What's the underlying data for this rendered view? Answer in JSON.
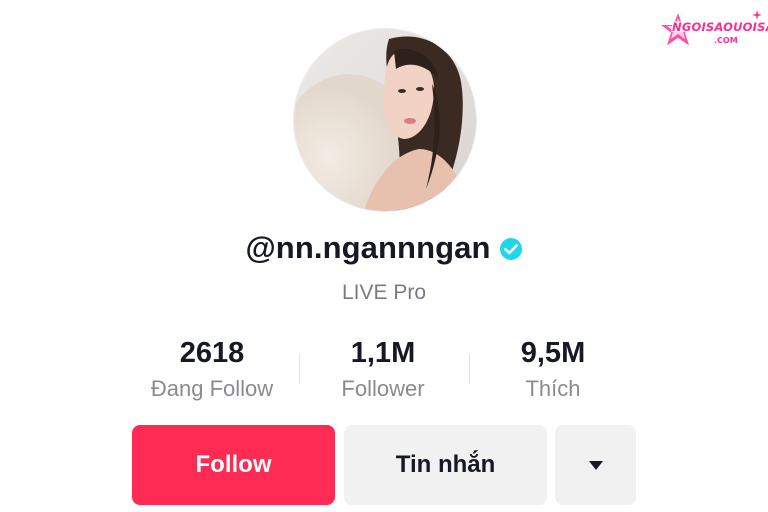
{
  "watermark": {
    "text": "NGOISAOUOISAO",
    "domain": ".COM",
    "color": "#ff2d8f"
  },
  "profile": {
    "avatar": "profile-photo",
    "username": "@nn.ngannngan",
    "verified": true,
    "verified_color": "#20d5ec",
    "bio": "LIVE Pro"
  },
  "stats": [
    {
      "value": "2618",
      "label": "Đang Follow"
    },
    {
      "value": "1,1M",
      "label": "Follower"
    },
    {
      "value": "9,5M",
      "label": "Thích"
    }
  ],
  "actions": {
    "follow_label": "Follow",
    "follow_color": "#fe2c55",
    "message_label": "Tin nhắn",
    "more_icon": "caret-down-icon"
  }
}
